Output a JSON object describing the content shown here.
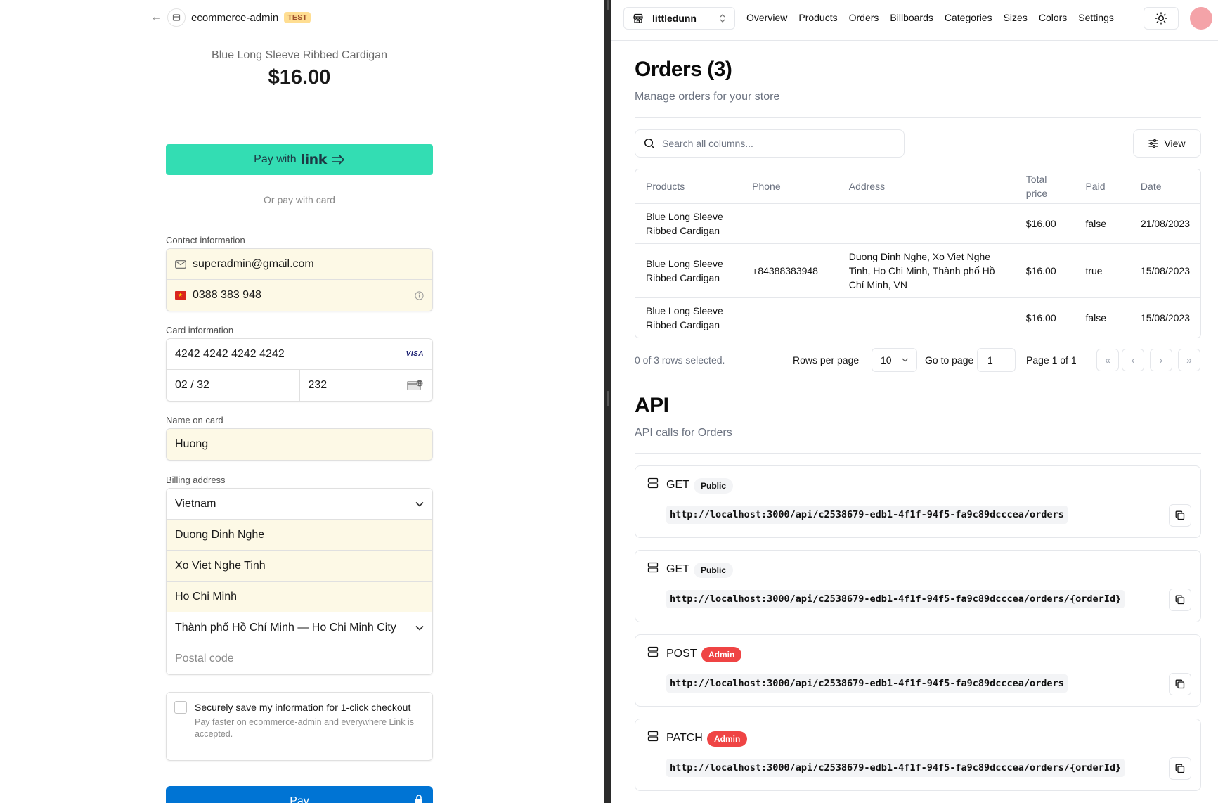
{
  "checkout": {
    "merchant": "ecommerce-admin",
    "test_badge": "TEST",
    "product_name": "Blue Long Sleeve Ribbed Cardigan",
    "price": "$16.00",
    "link_button": {
      "prefix": "Pay with",
      "brand": "link"
    },
    "or_divider": "Or pay with card",
    "contact": {
      "label": "Contact information",
      "email": "superadmin@gmail.com",
      "phone": "0388 383 948"
    },
    "card": {
      "label": "Card information",
      "number": "4242 4242 4242 4242",
      "brand": "VISA",
      "expiry": "02 / 32",
      "cvc": "232"
    },
    "name": {
      "label": "Name on card",
      "value": "Huong"
    },
    "billing": {
      "label": "Billing address",
      "country": "Vietnam",
      "line1": "Duong Dinh Nghe",
      "line2": "Xo Viet Nghe Tinh",
      "city": "Ho Chi Minh",
      "province": "Thành phố Hồ Chí Minh — Ho Chi Minh City",
      "postal_placeholder": "Postal code"
    },
    "save": {
      "title": "Securely save my information for 1-click checkout",
      "subtitle": "Pay faster on ecommerce-admin and everywhere Link is accepted."
    },
    "pay_button": "Pay"
  },
  "admin": {
    "store": "littledunn",
    "nav": [
      "Overview",
      "Products",
      "Orders",
      "Billboards",
      "Categories",
      "Sizes",
      "Colors",
      "Settings"
    ],
    "title": "Orders (3)",
    "subtitle": "Manage orders for your store",
    "search_placeholder": "Search all columns...",
    "view_button": "View",
    "table": {
      "headers": [
        "Products",
        "Phone",
        "Address",
        "Total price",
        "Paid",
        "Date"
      ],
      "rows": [
        {
          "products": "Blue Long Sleeve Ribbed Cardigan",
          "phone": "",
          "address": "",
          "total": "$16.00",
          "paid": "false",
          "date": "21/08/2023"
        },
        {
          "products": "Blue Long Sleeve Ribbed Cardigan",
          "phone": "+84388383948",
          "address": "Duong Dinh Nghe, Xo Viet Nghe Tinh, Ho Chi Minh, Thành phố Hồ Chí Minh, VN",
          "total": "$16.00",
          "paid": "true",
          "date": "15/08/2023"
        },
        {
          "products": "Blue Long Sleeve Ribbed Cardigan",
          "phone": "",
          "address": "",
          "total": "$16.00",
          "paid": "false",
          "date": "15/08/2023"
        }
      ]
    },
    "pager": {
      "selected": "0 of 3 rows selected.",
      "rows_per_page_label": "Rows per page",
      "rows_per_page": "10",
      "go_to_label": "Go to page",
      "go_to_value": "1",
      "page_of": "Page 1 of 1",
      "first": "«",
      "prev": "‹",
      "next": "›",
      "last": "»"
    },
    "api": {
      "title": "API",
      "subtitle": "API calls for Orders",
      "calls": [
        {
          "method": "GET",
          "badge": "Public",
          "url": "http://localhost:3000/api/c2538679-edb1-4f1f-94f5-fa9c89dcccea/orders"
        },
        {
          "method": "GET",
          "badge": "Public",
          "url": "http://localhost:3000/api/c2538679-edb1-4f1f-94f5-fa9c89dcccea/orders/{orderId}"
        },
        {
          "method": "POST",
          "badge": "Admin",
          "url": "http://localhost:3000/api/c2538679-edb1-4f1f-94f5-fa9c89dcccea/orders"
        },
        {
          "method": "PATCH",
          "badge": "Admin",
          "url": "http://localhost:3000/api/c2538679-edb1-4f1f-94f5-fa9c89dcccea/orders/{orderId}"
        }
      ]
    }
  },
  "colors": {
    "link_green": "#33ddb3",
    "pay_blue": "#0074d4",
    "autofill": "#fdf9e6",
    "admin_badge": "#ef4444",
    "test_badge": "#ffde92"
  },
  "icons": {
    "back": "arrow-left-icon",
    "mail": "mail-icon",
    "flag": "vietnam-flag-icon",
    "info": "info-icon",
    "visa": "visa-logo",
    "cvc": "cvc-card-icon",
    "chevron": "chevron-down-icon",
    "lock": "lock-icon",
    "store": "store-icon",
    "sun": "sun-icon",
    "search": "search-icon",
    "sliders": "sliders-icon",
    "server": "server-icon",
    "copy": "copy-icon"
  }
}
